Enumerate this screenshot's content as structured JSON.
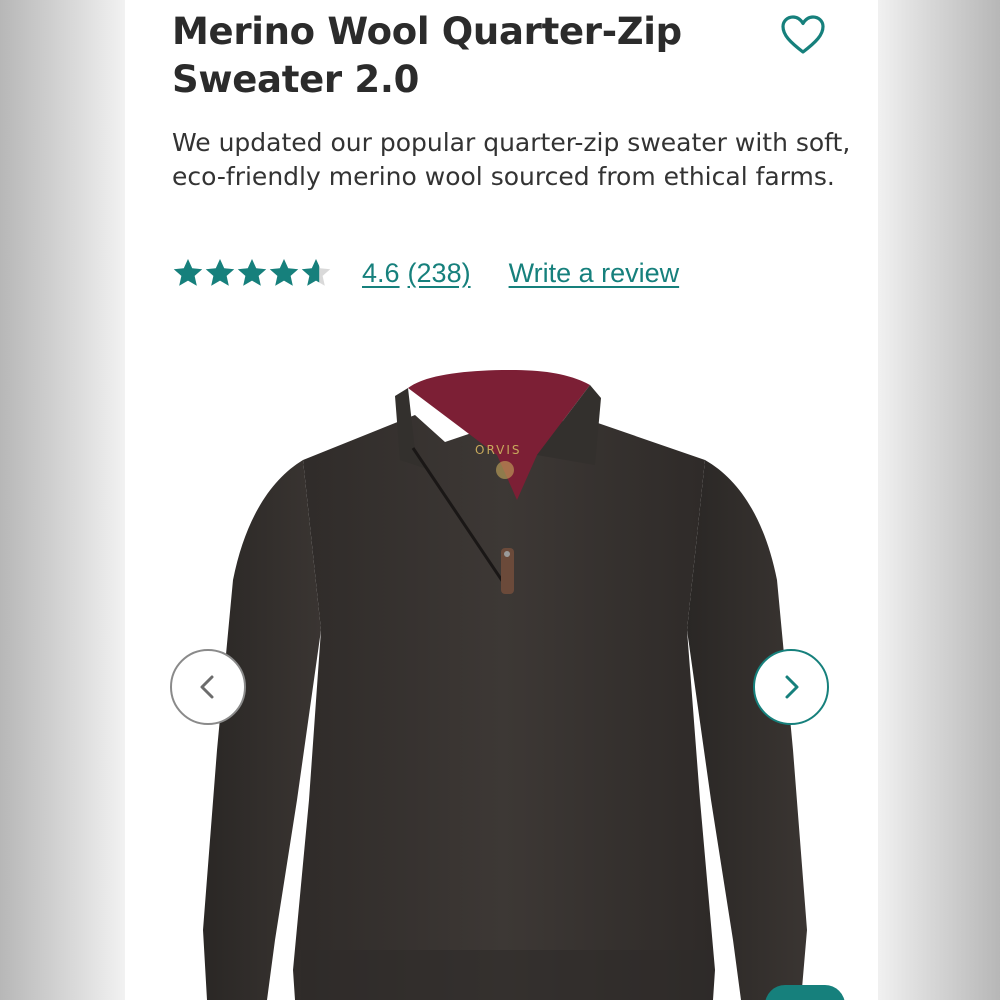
{
  "product": {
    "title": "Merino Wool Quarter-Zip Sweater 2.0",
    "description": "We updated our popular quarter-zip sweater with soft, eco-friendly merino wool sourced from ethical farms.",
    "favorite_icon": "heart-outline-icon"
  },
  "rating": {
    "stars": 4.6,
    "max_stars": 5,
    "score": "4.6",
    "count": "(238)",
    "write_review": "Write a review"
  },
  "gallery": {
    "prev_icon": "chevron-left-icon",
    "next_icon": "chevron-right-icon",
    "logo_text": "ORVIS"
  },
  "colors": {
    "accent": "#16807c",
    "text": "#2b2b2b",
    "sweater": "#3a3532",
    "collar_lining": "#7c1f35",
    "star_empty": "#d9d9d9"
  }
}
